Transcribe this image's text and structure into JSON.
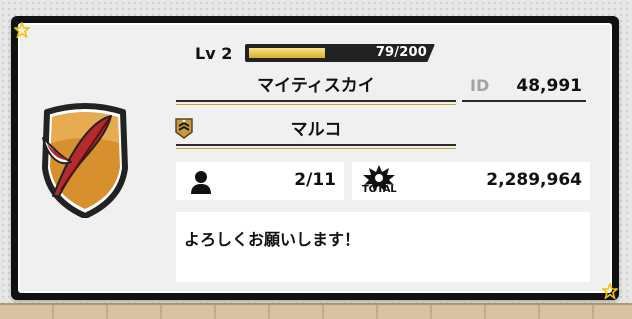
{
  "profile": {
    "level_label": "Lv 2",
    "xp_text": "79/200",
    "xp_progress": 0.395,
    "player_name": "マイティスカイ",
    "id_label": "ID",
    "id_value": "48,991",
    "rank_name": "マルコ",
    "members_value": "2/11",
    "total_label": "TOTAL",
    "total_value": "2,289,964",
    "message": "よろしくお願いします！"
  },
  "icons": {
    "emblem": "feather-shield-emblem-icon",
    "rank": "rank-badge-icon",
    "members": "person-icon",
    "total": "total-burst-icon",
    "corner": "star-icon"
  },
  "colors": {
    "xp_fill": "#d9b12c",
    "emblem_gold": "#d8902f",
    "feather_red": "#b52a2a"
  }
}
